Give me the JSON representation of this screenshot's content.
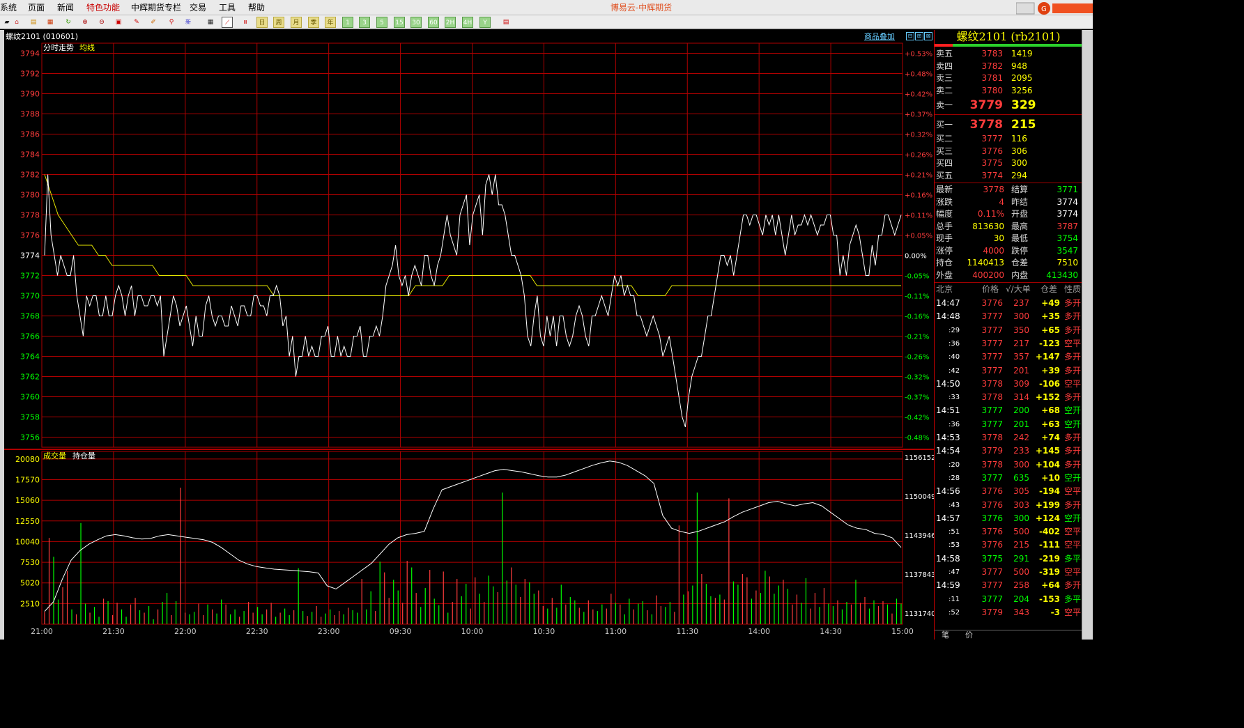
{
  "window": {
    "app_title": "博易云-中辉期货"
  },
  "menu": [
    "系统",
    "页面",
    "新闻",
    "特色功能",
    "中辉期货专栏",
    "交易",
    "工具",
    "帮助"
  ],
  "toolbar": {
    "period_buttons": [
      "日",
      "周",
      "月",
      "季",
      "年",
      "1",
      "3",
      "5",
      "15",
      "30",
      "60",
      "2H",
      "4H",
      "Y"
    ]
  },
  "header": {
    "contract": "螺纹2101 (010601)",
    "overlay": "商品叠加"
  },
  "price_chart": {
    "labels": {
      "title": "分时走势",
      "avg": "均线"
    },
    "left_ticks": [
      "3794",
      "3792",
      "3790",
      "3788",
      "3786",
      "3784",
      "3782",
      "3780",
      "3778",
      "3776",
      "3774",
      "3772",
      "3770",
      "3768",
      "3766",
      "3764",
      "3762",
      "3760",
      "3758",
      "3756"
    ],
    "right_ticks": [
      "+0.53%",
      "+0.48%",
      "+0.42%",
      "+0.37%",
      "+0.32%",
      "+0.26%",
      "+0.21%",
      "+0.16%",
      "+0.11%",
      "+0.05%",
      "0.00%",
      "-0.05%",
      "-0.11%",
      "-0.16%",
      "-0.21%",
      "-0.26%",
      "-0.32%",
      "-0.37%",
      "-0.42%",
      "-0.48%"
    ]
  },
  "volume_chart": {
    "labels": {
      "volume": "成交量",
      "oi": "持仓量"
    },
    "left_ticks": [
      "20080",
      "17570",
      "15060",
      "12550",
      "10040",
      "7530",
      "5020",
      "2510"
    ],
    "right_ticks": [
      "1156152",
      "1150049",
      "1143946",
      "1137843",
      "1131740"
    ]
  },
  "time_axis": [
    "21:00",
    "21:30",
    "22:00",
    "22:30",
    "23:00",
    "09:30",
    "10:00",
    "10:30",
    "11:00",
    "11:30",
    "14:00",
    "14:30",
    "15:00"
  ],
  "chart_data": {
    "type": "line",
    "prev_settle": 3774,
    "price_ylim": [
      3755,
      3795
    ],
    "oi_ylim": [
      1130000,
      1157000
    ],
    "vol_ylim": [
      0,
      21000
    ],
    "series": [
      {
        "name": "分时走势",
        "values": [
          3774,
          3782,
          3776,
          3774,
          3772,
          3774,
          3773,
          3772,
          3772,
          3774,
          3770,
          3768,
          3766,
          3770,
          3769,
          3770,
          3770,
          3768,
          3768,
          3770,
          3768,
          3768,
          3770,
          3771,
          3770,
          3768,
          3770,
          3771,
          3768,
          3770,
          3770,
          3769,
          3769,
          3770,
          3770,
          3769,
          3770,
          3764,
          3766,
          3768,
          3770,
          3769,
          3767,
          3768,
          3769,
          3767,
          3765,
          3768,
          3766,
          3766,
          3769,
          3770,
          3768,
          3767,
          3768,
          3768,
          3767,
          3767,
          3769,
          3768,
          3767,
          3769,
          3769,
          3768,
          3768,
          3770,
          3770,
          3769,
          3769,
          3768,
          3770,
          3770,
          3771,
          3770,
          3767,
          3768,
          3764,
          3766,
          3762,
          3764,
          3764,
          3766,
          3764,
          3765,
          3764,
          3764,
          3766,
          3766,
          3767,
          3764,
          3764,
          3766,
          3764,
          3765,
          3764,
          3764,
          3766,
          3766,
          3767,
          3764,
          3764,
          3766,
          3766,
          3767,
          3766,
          3768,
          3771,
          3772,
          3773,
          3775,
          3772,
          3771,
          3772,
          3770,
          3772,
          3773,
          3772,
          3771,
          3774,
          3774,
          3772,
          3771,
          3773,
          3774,
          3776,
          3778,
          3776,
          3775,
          3774,
          3778,
          3779,
          3780,
          3775,
          3778,
          3779,
          3780,
          3776,
          3781,
          3782,
          3780,
          3782,
          3779,
          3779,
          3778,
          3776,
          3774,
          3774,
          3773,
          3772,
          3770,
          3766,
          3765,
          3768,
          3770,
          3766,
          3765,
          3768,
          3766,
          3768,
          3765,
          3768,
          3768,
          3766,
          3765,
          3766,
          3768,
          3769,
          3768,
          3766,
          3765,
          3768,
          3768,
          3769,
          3770,
          3769,
          3768,
          3770,
          3772,
          3771,
          3772,
          3770,
          3771,
          3770,
          3770,
          3768,
          3768,
          3767,
          3766,
          3767,
          3768,
          3767,
          3766,
          3764,
          3765,
          3766,
          3764,
          3762,
          3760,
          3758,
          3757,
          3760,
          3762,
          3763,
          3764,
          3764,
          3766,
          3768,
          3768,
          3770,
          3772,
          3774,
          3774,
          3773,
          3774,
          3772,
          3774,
          3776,
          3778,
          3778,
          3777,
          3778,
          3778,
          3777,
          3776,
          3778,
          3777,
          3778,
          3776,
          3778,
          3776,
          3774,
          3776,
          3778,
          3776,
          3777,
          3777,
          3778,
          3777,
          3778,
          3777,
          3776,
          3777,
          3777,
          3778,
          3778,
          3776,
          3776,
          3772,
          3774,
          3772,
          3775,
          3776,
          3777,
          3776,
          3774,
          3772,
          3772,
          3775,
          3773,
          3776,
          3776,
          3778,
          3778,
          3777,
          3776,
          3777,
          3778
        ]
      },
      {
        "name": "均线",
        "values": [
          3782,
          3780,
          3778,
          3777,
          3776,
          3775,
          3775,
          3775,
          3774,
          3774,
          3773,
          3773,
          3773,
          3773,
          3773,
          3773,
          3773,
          3772,
          3772,
          3772,
          3772,
          3772,
          3771,
          3771,
          3771,
          3771,
          3771,
          3771,
          3771,
          3771,
          3771,
          3771,
          3771,
          3771,
          3770,
          3770,
          3770,
          3770,
          3770,
          3770,
          3770,
          3770,
          3770,
          3770,
          3770,
          3770,
          3770,
          3770,
          3770,
          3770,
          3770,
          3770,
          3770,
          3770,
          3770,
          3771,
          3771,
          3771,
          3771,
          3771,
          3772,
          3772,
          3772,
          3772,
          3772,
          3772,
          3772,
          3772,
          3772,
          3772,
          3772,
          3772,
          3772,
          3771,
          3771,
          3771,
          3771,
          3771,
          3771,
          3771,
          3771,
          3771,
          3771,
          3771,
          3771,
          3771,
          3771,
          3771,
          3770,
          3770,
          3770,
          3770,
          3770,
          3771,
          3771,
          3771,
          3771,
          3771,
          3771,
          3771,
          3771,
          3771,
          3771,
          3771,
          3771,
          3771,
          3771,
          3771,
          3771,
          3771,
          3771,
          3771,
          3771,
          3771,
          3771,
          3771,
          3771,
          3771,
          3771,
          3771,
          3771,
          3771,
          3771,
          3771,
          3771,
          3771,
          3771,
          3771
        ]
      },
      {
        "name": "持仓量",
        "values": [
          1132000,
          1133500,
          1137000,
          1140000,
          1141500,
          1142500,
          1143200,
          1143800,
          1144000,
          1143800,
          1143500,
          1143300,
          1143400,
          1143800,
          1144000,
          1143800,
          1143600,
          1143400,
          1143200,
          1142800,
          1142000,
          1141000,
          1140000,
          1139400,
          1139000,
          1138800,
          1138600,
          1138500,
          1138400,
          1138300,
          1138200,
          1138000,
          1136000,
          1135500,
          1136500,
          1137500,
          1138500,
          1139500,
          1141000,
          1142500,
          1143500,
          1144000,
          1144200,
          1144500,
          1148000,
          1151000,
          1151500,
          1152000,
          1152500,
          1153000,
          1153500,
          1154000,
          1154200,
          1154000,
          1153800,
          1153500,
          1153200,
          1153000,
          1153000,
          1153300,
          1153800,
          1154300,
          1154800,
          1155200,
          1155500,
          1155300,
          1154800,
          1154000,
          1153200,
          1152000,
          1147000,
          1145000,
          1144500,
          1144200,
          1144500,
          1145000,
          1145500,
          1146000,
          1146800,
          1147500,
          1148000,
          1148500,
          1149000,
          1149200,
          1148800,
          1148500,
          1148800,
          1149000,
          1148500,
          1147500,
          1146500,
          1145500,
          1145000,
          1144800,
          1144200,
          1144000,
          1143500,
          1142000
        ]
      },
      {
        "name": "成交量",
        "values": [
          1500,
          10500,
          8200,
          3000,
          4500,
          6500,
          1800,
          1200,
          12300,
          2500,
          1400,
          2100,
          900,
          3100,
          2800,
          1100,
          2600,
          1800,
          900,
          2400,
          3200,
          1700,
          1400,
          2200,
          600,
          1800,
          2700,
          3800,
          1100,
          2800,
          16600,
          1400,
          1200,
          1500,
          2500,
          1100,
          2400,
          1800,
          1300,
          3000,
          2400,
          1200,
          1800,
          900,
          1600,
          2700,
          1400,
          2100,
          1200,
          1800,
          2600,
          900,
          1400,
          1900,
          1100,
          1700,
          6800,
          1600,
          1000,
          1500,
          2200,
          900,
          1300,
          1800,
          1100,
          1600,
          1200,
          2000,
          1700,
          1400,
          5500,
          1800,
          4000,
          1600,
          7600,
          6300,
          3200,
          5400,
          4100,
          2600,
          7700,
          6900,
          3800,
          2100,
          4400,
          6600,
          3100,
          2300,
          6400,
          1400,
          2700,
          5500,
          3400,
          4900,
          1900,
          5700,
          3700,
          2700,
          5900,
          4600,
          3900,
          16000,
          5300,
          6900,
          4800,
          3300,
          5500,
          5100,
          3700,
          4100,
          2200,
          1900,
          3200,
          2000,
          4800,
          2400,
          3300,
          2900,
          2000,
          1500,
          2900,
          1800,
          1600,
          2400,
          1900,
          3700,
          2600,
          2400,
          1200,
          3100,
          1800,
          2500,
          2800,
          1700,
          1200,
          3500,
          2200,
          2100,
          2700,
          1500,
          12000,
          3600,
          4000,
          4700,
          16000,
          6100,
          4900,
          3400,
          3200,
          3600,
          3000,
          15300,
          5200,
          4800,
          6100,
          5700,
          3100,
          4100,
          3800,
          6500,
          5800,
          3700,
          4700,
          5400,
          4300,
          2400,
          3600,
          2600,
          5600,
          1900,
          3800,
          2100,
          4400,
          2500,
          2200,
          2900,
          1800,
          2700,
          2400,
          5400,
          2600,
          3300,
          1900,
          2900,
          2200,
          2800,
          2400,
          1300,
          3100,
          2500
        ]
      }
    ]
  },
  "quote": {
    "title": "螺纹2101 (rb2101)",
    "asks": [
      {
        "label": "卖五",
        "price": "3783",
        "vol": "1419"
      },
      {
        "label": "卖四",
        "price": "3782",
        "vol": "948"
      },
      {
        "label": "卖三",
        "price": "3781",
        "vol": "2095"
      },
      {
        "label": "卖二",
        "price": "3780",
        "vol": "3256"
      },
      {
        "label": "卖一",
        "price": "3779",
        "vol": "329"
      }
    ],
    "bids": [
      {
        "label": "买一",
        "price": "3778",
        "vol": "215"
      },
      {
        "label": "买二",
        "price": "3777",
        "vol": "116"
      },
      {
        "label": "买三",
        "price": "3776",
        "vol": "306"
      },
      {
        "label": "买四",
        "price": "3775",
        "vol": "300"
      },
      {
        "label": "买五",
        "price": "3774",
        "vol": "294"
      }
    ],
    "stats": [
      {
        "l1": "最新",
        "v1": "3778",
        "c1": "r",
        "l2": "结算",
        "v2": "3771",
        "c2": "g"
      },
      {
        "l1": "涨跌",
        "v1": "4",
        "c1": "r",
        "l2": "昨结",
        "v2": "3774",
        "c2": "w"
      },
      {
        "l1": "幅度",
        "v1": "0.11%",
        "c1": "r",
        "l2": "开盘",
        "v2": "3774",
        "c2": "w"
      },
      {
        "l1": "总手",
        "v1": "813630",
        "c1": "y",
        "l2": "最高",
        "v2": "3787",
        "c2": "r"
      },
      {
        "l1": "现手",
        "v1": "30",
        "c1": "y",
        "l2": "最低",
        "v2": "3754",
        "c2": "g"
      },
      {
        "l1": "涨停",
        "v1": "4000",
        "c1": "r",
        "l2": "跌停",
        "v2": "3547",
        "c2": "g"
      },
      {
        "l1": "持仓",
        "v1": "1140413",
        "c1": "y",
        "l2": "仓差",
        "v2": "7510",
        "c2": "y"
      },
      {
        "l1": "外盘",
        "v1": "400200",
        "c1": "r",
        "l2": "内盘",
        "v2": "413430",
        "c2": "g"
      }
    ],
    "tick_header": {
      "time": "北京",
      "price": "价格",
      "vol": "√/大单",
      "oi": "仓差",
      "nature": "性质"
    },
    "ticks": [
      {
        "t": "14:47",
        "p": "3776",
        "v": "237",
        "d": "+49",
        "n": "多开",
        "pc": "r",
        "nc": "r"
      },
      {
        "t": "14:48",
        "p": "3777",
        "v": "300",
        "d": "+35",
        "n": "多开",
        "pc": "r",
        "nc": "r"
      },
      {
        "t": ":29",
        "p": "3777",
        "v": "350",
        "d": "+65",
        "n": "多开",
        "pc": "r",
        "nc": "r"
      },
      {
        "t": ":36",
        "p": "3777",
        "v": "217",
        "d": "-123",
        "n": "空平",
        "pc": "r",
        "nc": "r"
      },
      {
        "t": ":40",
        "p": "3777",
        "v": "357",
        "d": "+147",
        "n": "多开",
        "pc": "r",
        "nc": "r"
      },
      {
        "t": ":42",
        "p": "3777",
        "v": "201",
        "d": "+39",
        "n": "多开",
        "pc": "r",
        "nc": "r"
      },
      {
        "t": "14:50",
        "p": "3778",
        "v": "309",
        "d": "-106",
        "n": "空平",
        "pc": "r",
        "nc": "r"
      },
      {
        "t": ":33",
        "p": "3778",
        "v": "314",
        "d": "+152",
        "n": "多开",
        "pc": "r",
        "nc": "r"
      },
      {
        "t": "14:51",
        "p": "3777",
        "v": "200",
        "d": "+68",
        "n": "空开",
        "pc": "g",
        "nc": "g"
      },
      {
        "t": ":36",
        "p": "3777",
        "v": "201",
        "d": "+63",
        "n": "空开",
        "pc": "g",
        "nc": "g"
      },
      {
        "t": "14:53",
        "p": "3778",
        "v": "242",
        "d": "+74",
        "n": "多开",
        "pc": "r",
        "nc": "r"
      },
      {
        "t": "14:54",
        "p": "3779",
        "v": "233",
        "d": "+145",
        "n": "多开",
        "pc": "r",
        "nc": "r"
      },
      {
        "t": ":20",
        "p": "3778",
        "v": "300",
        "d": "+104",
        "n": "多开",
        "pc": "r",
        "nc": "r"
      },
      {
        "t": ":28",
        "p": "3777",
        "v": "635",
        "d": "+10",
        "n": "空开",
        "pc": "g",
        "nc": "g"
      },
      {
        "t": "14:56",
        "p": "3776",
        "v": "305",
        "d": "-194",
        "n": "空平",
        "pc": "r",
        "nc": "r"
      },
      {
        "t": ":43",
        "p": "3776",
        "v": "303",
        "d": "+199",
        "n": "多开",
        "pc": "r",
        "nc": "r"
      },
      {
        "t": "14:57",
        "p": "3776",
        "v": "300",
        "d": "+124",
        "n": "空开",
        "pc": "g",
        "nc": "g"
      },
      {
        "t": ":51",
        "p": "3776",
        "v": "500",
        "d": "-402",
        "n": "空平",
        "pc": "r",
        "nc": "r"
      },
      {
        "t": ":53",
        "p": "3776",
        "v": "215",
        "d": "-111",
        "n": "空平",
        "pc": "r",
        "nc": "r"
      },
      {
        "t": "14:58",
        "p": "3775",
        "v": "291",
        "d": "-219",
        "n": "多平",
        "pc": "g",
        "nc": "g"
      },
      {
        "t": ":47",
        "p": "3777",
        "v": "500",
        "d": "-319",
        "n": "空平",
        "pc": "r",
        "nc": "r"
      },
      {
        "t": "14:59",
        "p": "3777",
        "v": "258",
        "d": "+64",
        "n": "多开",
        "pc": "r",
        "nc": "r"
      },
      {
        "t": ":11",
        "p": "3777",
        "v": "204",
        "d": "-153",
        "n": "多平",
        "pc": "g",
        "nc": "g"
      },
      {
        "t": ":52",
        "p": "3779",
        "v": "343",
        "d": "-3",
        "n": "空平",
        "pc": "r",
        "nc": "r"
      }
    ],
    "tabs": [
      "笔",
      "价"
    ]
  },
  "colors": {
    "grid": "#b00000",
    "up": "#ff3c3c",
    "down": "#00ff00",
    "price_line": "#ffffff",
    "avg_line": "#e6e600",
    "oi_line": "#ffffff"
  }
}
